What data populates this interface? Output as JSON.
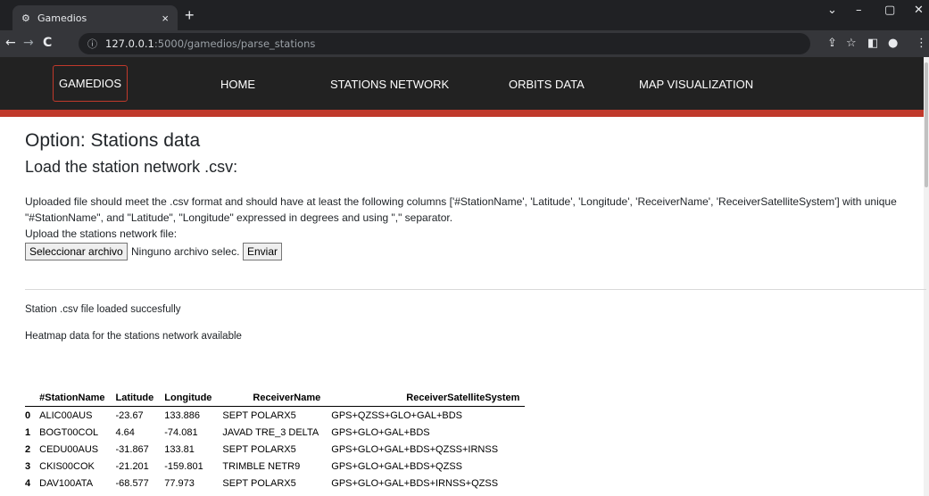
{
  "browser": {
    "tab_title": "Gamedios",
    "tab_close": "×",
    "new_tab": "+",
    "url_host": "127.0.0.1",
    "url_path": ":5000/gamedios/parse_stations",
    "icons": [
      "back-icon",
      "forward-icon",
      "reload-icon",
      "info-icon",
      "share-icon",
      "star-icon",
      "sidepanel-icon",
      "profile-icon",
      "menu-icon"
    ]
  },
  "navbar": {
    "brand": "GAMEDIOS",
    "links": [
      "HOME",
      "STATIONS NETWORK",
      "ORBITS DATA",
      "MAP VISUALIZATION"
    ],
    "accent_color": "#c0392b"
  },
  "page": {
    "title": "Option: Stations data",
    "subtitle": "Load the station network .csv:",
    "description": "Uploaded file should meet the .csv format and should have at least the following columns ['#StationName', 'Latitude', 'Longitude', 'ReceiverName', 'ReceiverSatelliteSystem'] with unique \"#StationName\", and \"Latitude\", \"Longitude\" expressed in degrees and using \",\" separator.",
    "upload_label": "Upload the stations network file:",
    "file_button": "Seleccionar archivo",
    "no_file_text": "Ninguno archivo selec.",
    "submit_button": "Enviar",
    "message_loaded": "Station .csv file loaded succesfully",
    "message_heatmap": "Heatmap data for the stations network available"
  },
  "table": {
    "columns": [
      "#StationName",
      "Latitude",
      "Longitude",
      "ReceiverName",
      "ReceiverSatelliteSystem"
    ],
    "rows": [
      {
        "index": "0",
        "cells": [
          "ALIC00AUS",
          "-23.67",
          "133.886",
          "SEPT POLARX5",
          "GPS+QZSS+GLO+GAL+BDS"
        ]
      },
      {
        "index": "1",
        "cells": [
          "BOGT00COL",
          "4.64",
          "-74.081",
          "JAVAD TRE_3 DELTA",
          "GPS+GLO+GAL+BDS"
        ]
      },
      {
        "index": "2",
        "cells": [
          "CEDU00AUS",
          "-31.867",
          "133.81",
          "SEPT POLARX5",
          "GPS+GLO+GAL+BDS+QZSS+IRNSS"
        ]
      },
      {
        "index": "3",
        "cells": [
          "CKIS00COK",
          "-21.201",
          "-159.801",
          "TRIMBLE NETR9",
          "GPS+GLO+GAL+BDS+QZSS"
        ]
      },
      {
        "index": "4",
        "cells": [
          "DAV100ATA",
          "-68.577",
          "77.973",
          "SEPT POLARX5",
          "GPS+GLO+GAL+BDS+IRNSS+QZSS"
        ]
      }
    ]
  }
}
